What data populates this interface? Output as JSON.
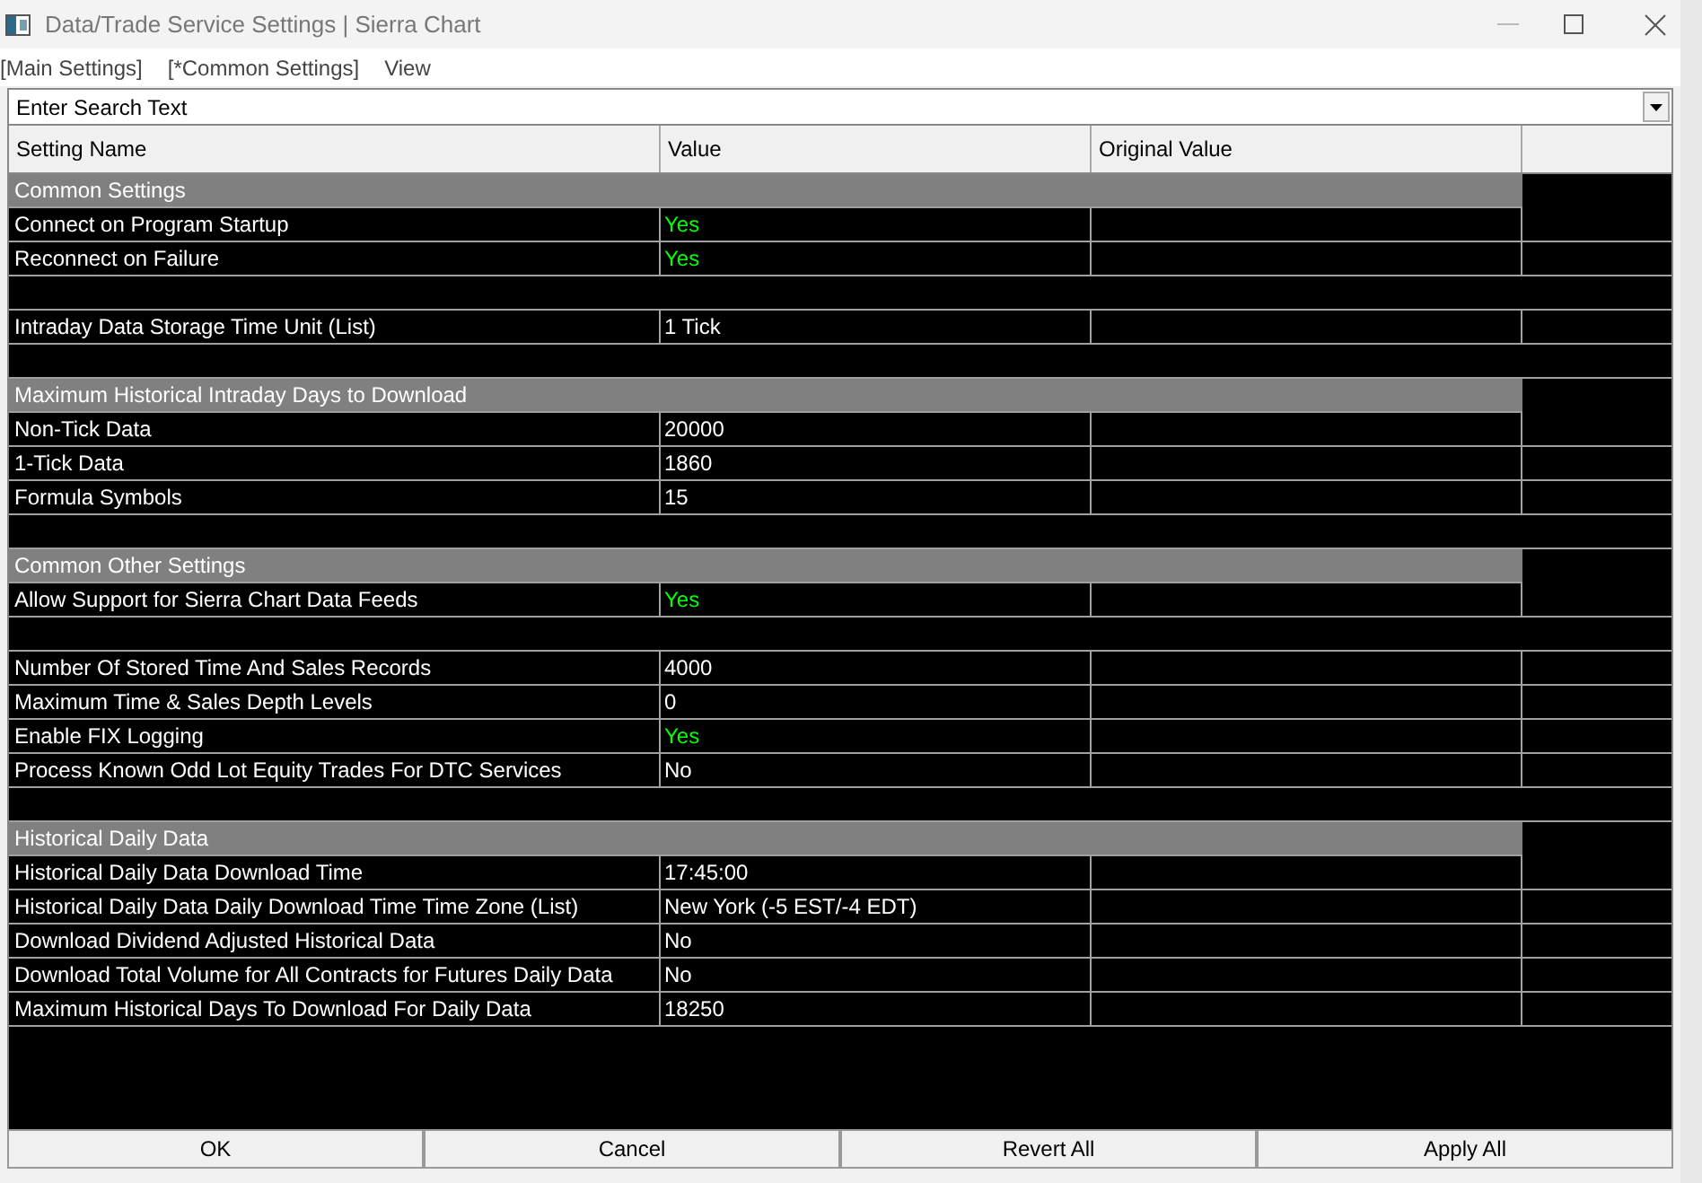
{
  "window": {
    "title": "Data/Trade Service Settings | Sierra Chart"
  },
  "menu": [
    "[Main Settings]",
    "[*Common Settings]",
    "View"
  ],
  "search": {
    "placeholder": "Enter Search Text"
  },
  "table": {
    "columns": [
      "Setting Name",
      "Value",
      "Original Value"
    ],
    "rows": [
      {
        "kind": "section",
        "name": "Common Settings"
      },
      {
        "kind": "setting",
        "name": "Connect on Program Startup",
        "value": "Yes",
        "highlighted": true
      },
      {
        "kind": "setting",
        "name": "Reconnect on Failure",
        "value": "Yes",
        "highlighted": true
      },
      {
        "kind": "blank"
      },
      {
        "kind": "setting",
        "name": "Intraday Data Storage Time Unit (List)",
        "value": "1 Tick",
        "highlighted": false
      },
      {
        "kind": "blank"
      },
      {
        "kind": "section",
        "name": "Maximum Historical Intraday Days to Download"
      },
      {
        "kind": "setting",
        "name": "Non-Tick Data",
        "value": "20000",
        "highlighted": false
      },
      {
        "kind": "setting",
        "name": "1-Tick Data",
        "value": "1860",
        "highlighted": false
      },
      {
        "kind": "setting",
        "name": "Formula Symbols",
        "value": "15",
        "highlighted": false
      },
      {
        "kind": "blank"
      },
      {
        "kind": "section",
        "name": "Common Other Settings"
      },
      {
        "kind": "setting",
        "name": "Allow Support for Sierra Chart Data Feeds",
        "value": "Yes",
        "highlighted": true
      },
      {
        "kind": "blank"
      },
      {
        "kind": "setting",
        "name": "Number Of Stored Time And Sales Records",
        "value": "4000",
        "highlighted": false
      },
      {
        "kind": "setting",
        "name": "Maximum Time & Sales Depth Levels",
        "value": "0",
        "highlighted": false
      },
      {
        "kind": "setting",
        "name": "Enable FIX Logging",
        "value": "Yes",
        "highlighted": true
      },
      {
        "kind": "setting",
        "name": "Process Known Odd Lot Equity Trades For DTC Services",
        "value": "No",
        "highlighted": false
      },
      {
        "kind": "blank"
      },
      {
        "kind": "section",
        "name": "Historical Daily Data"
      },
      {
        "kind": "setting",
        "name": "Historical Daily Data Download Time",
        "value": "17:45:00",
        "highlighted": false
      },
      {
        "kind": "setting",
        "name": "Historical Daily Data Daily Download Time Time Zone (List)",
        "value": "New York (-5 EST/-4 EDT)",
        "highlighted": false
      },
      {
        "kind": "setting",
        "name": "Download Dividend Adjusted Historical Data",
        "value": "No",
        "highlighted": false
      },
      {
        "kind": "setting",
        "name": "Download Total Volume for All Contracts for Futures Daily Data",
        "value": "No",
        "highlighted": false
      },
      {
        "kind": "setting",
        "name": "Maximum Historical Days To Download For Daily Data",
        "value": "18250",
        "highlighted": false
      }
    ]
  },
  "buttons": [
    "OK",
    "Cancel",
    "Revert All",
    "Apply All"
  ]
}
